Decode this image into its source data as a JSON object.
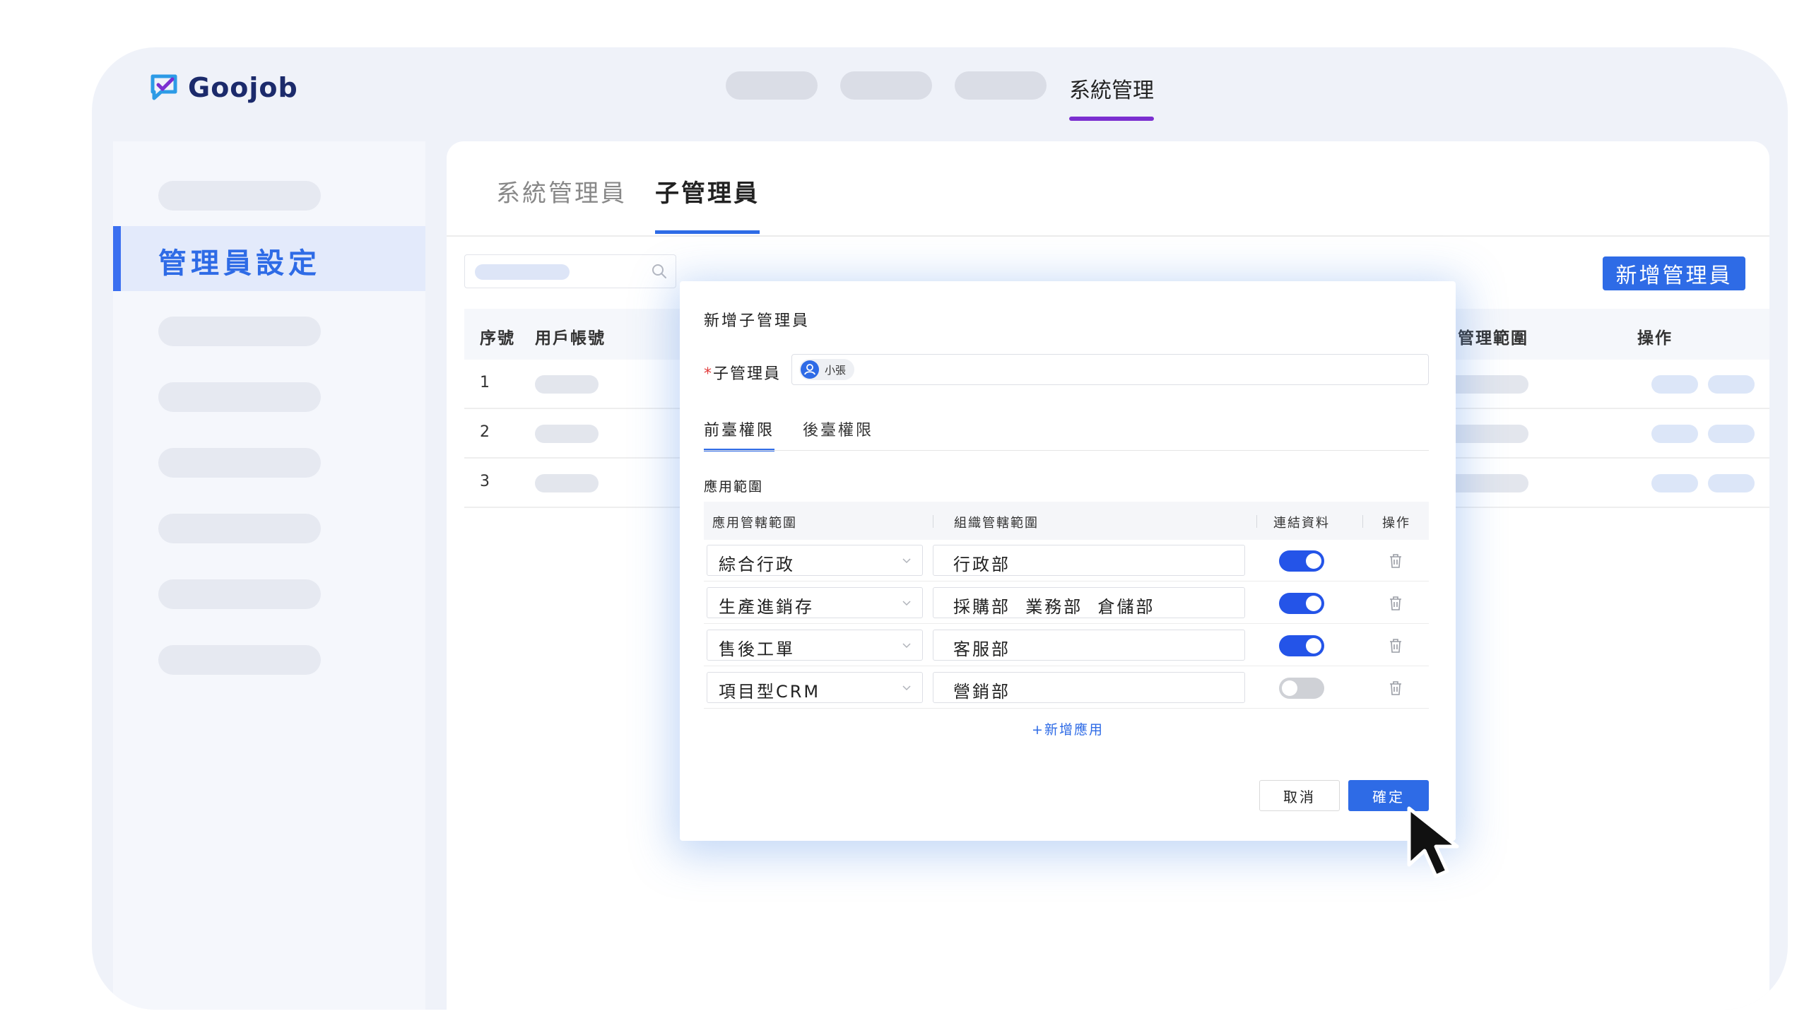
{
  "brand": {
    "name": "Goojob",
    "colors": {
      "primary": "#2e6be6",
      "accent": "#7b2fd0"
    }
  },
  "topnav": {
    "active_label": "系統管理"
  },
  "sidebar": {
    "active_label": "管理員設定"
  },
  "tabs": [
    {
      "label": "系統管理員"
    },
    {
      "label": "子管理員"
    }
  ],
  "toolbar": {
    "add_admin_label": "新增管理員"
  },
  "table": {
    "headers": {
      "index": "序號",
      "account": "用戶帳號",
      "scope": "管理範圍",
      "actions": "操作"
    },
    "rows": [
      {
        "index": "1"
      },
      {
        "index": "2"
      },
      {
        "index": "3"
      }
    ]
  },
  "modal": {
    "title": "新增子管理員",
    "field_required_mark": "*",
    "field_label": "子管理員",
    "selected_user": "小張",
    "tabs": [
      {
        "label": "前臺權限"
      },
      {
        "label": "後臺權限"
      }
    ],
    "section_title": "應用範圍",
    "perm_headers": {
      "app_scope": "應用管轄範圍",
      "org_scope": "組織管轄範圍",
      "link_data": "連結資料",
      "actions": "操作"
    },
    "perm_rows": [
      {
        "app": "綜合行政",
        "org": "行政部",
        "linked": true
      },
      {
        "app": "生產進銷存",
        "org": "採購部  業務部  倉儲部",
        "linked": true
      },
      {
        "app": "售後工單",
        "org": "客服部",
        "linked": true
      },
      {
        "app": "項目型CRM",
        "org": "營銷部",
        "linked": false
      }
    ],
    "add_app_label": "+新增應用",
    "cancel_label": "取消",
    "confirm_label": "確定"
  }
}
